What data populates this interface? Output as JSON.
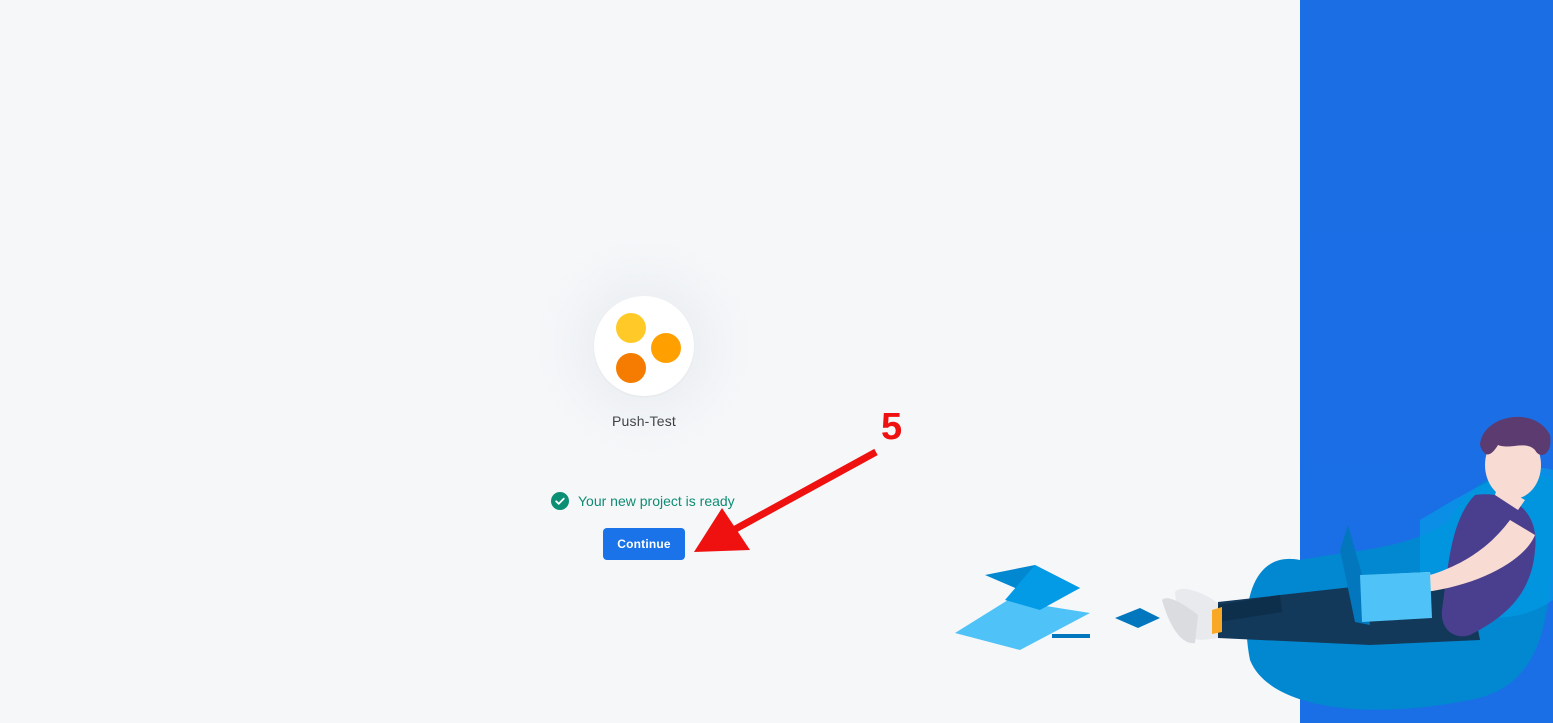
{
  "project": {
    "name": "Push-Test",
    "logo_icon": "project-dots-icon",
    "dot_colors": [
      "#ffca28",
      "#ffa000",
      "#f57c00"
    ]
  },
  "status": {
    "text": "Your new project is ready",
    "icon": "check-circle-icon",
    "color": "#0f8c73"
  },
  "actions": {
    "continue_label": "Continue"
  },
  "annotation": {
    "number": "5",
    "color": "#ef1010"
  },
  "colors": {
    "background": "#f5f7f9",
    "accent": "#1a73e8",
    "panel": "#1c6ee4"
  }
}
